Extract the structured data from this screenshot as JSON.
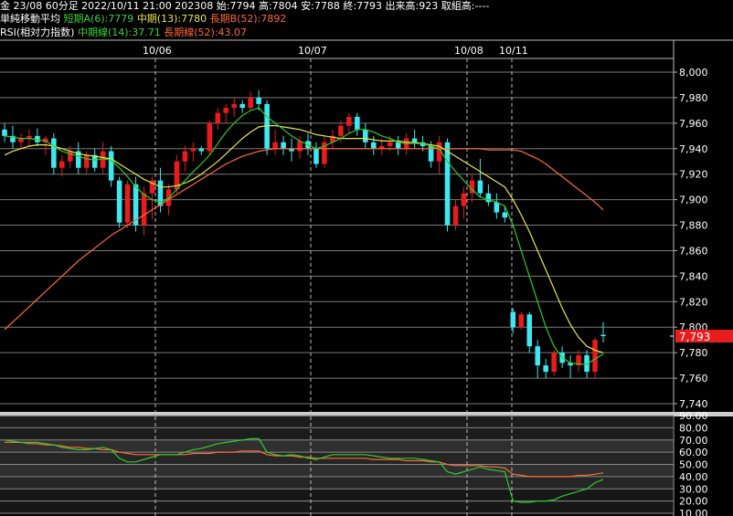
{
  "header": {
    "line1": "金 23/08 60分足 2022/10/11 21:00 202308 始:7794 高:7804 安:7788 終:7793 出来高:923 取組高:----",
    "line2_prefix": "単純移動平均",
    "line2_short": "短期A(6):7779",
    "line2_mid": "中期(13):7780",
    "line2_long": "長期B(52):7892",
    "line3_prefix": "RSI(相対力指数)",
    "line3_mid": "中期線(14):37.71",
    "line3_long": "長期線(52):43.07"
  },
  "colors": {
    "up": "#e81c1c",
    "down": "#3ee8f0",
    "ma_short": "#2ecc2e",
    "ma_mid": "#e8e84a",
    "ma_long": "#ff6a3a",
    "last_price_bg": "#e81c1c"
  },
  "chart_data": [
    {
      "type": "candlestick",
      "title": "金 23/08 60分足",
      "date_labels": [
        "10/06",
        "10/07",
        "10/08",
        "10/11"
      ],
      "date_separators": [
        170,
        340,
        511,
        560
      ],
      "ylim": [
        7735,
        8005
      ],
      "yticks": [
        8000,
        7980,
        7960,
        7940,
        7920,
        7900,
        7880,
        7860,
        7840,
        7820,
        7800,
        7780,
        7760,
        7740
      ],
      "ytick_labels": [
        "8,000",
        "7,980",
        "7,960",
        "7,940",
        "7,920",
        "7,900",
        "7,880",
        "7,860",
        "7,840",
        "7,820",
        "7,800",
        "7,780",
        "7,760",
        "7,740"
      ],
      "last_price": 7793,
      "last_price_label": "7,793",
      "candles": [
        [
          7955,
          7960,
          7945,
          7950
        ],
        [
          7950,
          7958,
          7940,
          7945
        ],
        [
          7945,
          7952,
          7940,
          7948
        ],
        [
          7948,
          7955,
          7942,
          7950
        ],
        [
          7950,
          7956,
          7942,
          7945
        ],
        [
          7945,
          7950,
          7935,
          7948
        ],
        [
          7948,
          7952,
          7920,
          7925
        ],
        [
          7925,
          7935,
          7918,
          7930
        ],
        [
          7930,
          7942,
          7925,
          7938
        ],
        [
          7938,
          7945,
          7920,
          7925
        ],
        [
          7925,
          7938,
          7920,
          7935
        ],
        [
          7935,
          7940,
          7922,
          7925
        ],
        [
          7925,
          7945,
          7920,
          7938
        ],
        [
          7938,
          7942,
          7910,
          7915
        ],
        [
          7915,
          7918,
          7878,
          7882
        ],
        [
          7882,
          7915,
          7878,
          7912
        ],
        [
          7912,
          7918,
          7875,
          7880
        ],
        [
          7880,
          7910,
          7872,
          7905
        ],
        [
          7905,
          7918,
          7885,
          7915
        ],
        [
          7915,
          7925,
          7890,
          7895
        ],
        [
          7895,
          7912,
          7888,
          7908
        ],
        [
          7908,
          7935,
          7905,
          7930
        ],
        [
          7930,
          7942,
          7922,
          7938
        ],
        [
          7938,
          7945,
          7930,
          7940
        ],
        [
          7940,
          7942,
          7935,
          7938
        ],
        [
          7938,
          7962,
          7935,
          7960
        ],
        [
          7960,
          7972,
          7955,
          7968
        ],
        [
          7968,
          7975,
          7960,
          7972
        ],
        [
          7972,
          7980,
          7965,
          7975
        ],
        [
          7975,
          7978,
          7968,
          7972
        ],
        [
          7972,
          7985,
          7970,
          7980
        ],
        [
          7980,
          7986,
          7970,
          7975
        ],
        [
          7975,
          7978,
          7935,
          7940
        ],
        [
          7940,
          7955,
          7935,
          7945
        ],
        [
          7945,
          7950,
          7935,
          7940
        ],
        [
          7940,
          7948,
          7930,
          7938
        ],
        [
          7938,
          7950,
          7932,
          7946
        ],
        [
          7946,
          7952,
          7935,
          7940
        ],
        [
          7940,
          7945,
          7925,
          7928
        ],
        [
          7928,
          7950,
          7925,
          7945
        ],
        [
          7945,
          7955,
          7940,
          7950
        ],
        [
          7950,
          7962,
          7945,
          7958
        ],
        [
          7958,
          7968,
          7952,
          7965
        ],
        [
          7965,
          7968,
          7950,
          7955
        ],
        [
          7955,
          7960,
          7940,
          7945
        ],
        [
          7945,
          7950,
          7935,
          7940
        ],
        [
          7940,
          7948,
          7935,
          7942
        ],
        [
          7942,
          7950,
          7938,
          7945
        ],
        [
          7945,
          7950,
          7935,
          7940
        ],
        [
          7940,
          7952,
          7935,
          7948
        ],
        [
          7948,
          7955,
          7940,
          7945
        ],
        [
          7945,
          7950,
          7938,
          7942
        ],
        [
          7942,
          7946,
          7925,
          7930
        ],
        [
          7930,
          7950,
          7920,
          7945
        ],
        [
          7945,
          7948,
          7875,
          7880
        ],
        [
          7880,
          7900,
          7876,
          7895
        ],
        [
          7895,
          7910,
          7885,
          7905
        ],
        [
          7905,
          7920,
          7898,
          7915
        ],
        [
          7915,
          7932,
          7902,
          7905
        ],
        [
          7905,
          7912,
          7895,
          7898
        ],
        [
          7898,
          7905,
          7885,
          7890
        ],
        [
          7890,
          7895,
          7882,
          7886
        ],
        [
          7812,
          7815,
          7795,
          7800
        ],
        [
          7800,
          7812,
          7798,
          7810
        ],
        [
          7810,
          7812,
          7780,
          7785
        ],
        [
          7785,
          7790,
          7760,
          7770
        ],
        [
          7770,
          7775,
          7760,
          7765
        ],
        [
          7765,
          7782,
          7762,
          7780
        ],
        [
          7780,
          7785,
          7768,
          7772
        ],
        [
          7772,
          7778,
          7760,
          7770
        ],
        [
          7770,
          7782,
          7765,
          7778
        ],
        [
          7778,
          7782,
          7760,
          7765
        ],
        [
          7765,
          7792,
          7760,
          7790
        ],
        [
          7794,
          7804,
          7788,
          7793
        ]
      ],
      "ma_short": [
        7950,
        7949,
        7948,
        7948,
        7947,
        7946,
        7942,
        7938,
        7936,
        7934,
        7932,
        7931,
        7932,
        7931,
        7925,
        7918,
        7910,
        7904,
        7900,
        7898,
        7901,
        7908,
        7915,
        7922,
        7928,
        7935,
        7944,
        7953,
        7960,
        7966,
        7970,
        7972,
        7965,
        7960,
        7955,
        7950,
        7946,
        7943,
        7940,
        7942,
        7945,
        7948,
        7952,
        7955,
        7955,
        7953,
        7950,
        7948,
        7945,
        7944,
        7944,
        7944,
        7942,
        7940,
        7930,
        7922,
        7915,
        7908,
        7902,
        7900,
        7898,
        7895,
        7880,
        7860,
        7840,
        7820,
        7800,
        7785,
        7776,
        7772,
        7771,
        7771,
        7775,
        7779
      ],
      "ma_mid": [
        7935,
        7938,
        7940,
        7942,
        7943,
        7943,
        7942,
        7940,
        7938,
        7936,
        7935,
        7934,
        7933,
        7932,
        7928,
        7924,
        7920,
        7916,
        7913,
        7910,
        7910,
        7911,
        7913,
        7916,
        7920,
        7925,
        7930,
        7936,
        7942,
        7948,
        7953,
        7957,
        7958,
        7958,
        7957,
        7956,
        7955,
        7953,
        7951,
        7950,
        7949,
        7948,
        7948,
        7948,
        7948,
        7947,
        7946,
        7946,
        7946,
        7945,
        7945,
        7944,
        7943,
        7942,
        7938,
        7934,
        7930,
        7926,
        7922,
        7918,
        7914,
        7910,
        7900,
        7888,
        7875,
        7860,
        7845,
        7830,
        7815,
        7802,
        7792,
        7785,
        7782,
        7780
      ],
      "ma_long": [
        7798,
        7804,
        7810,
        7816,
        7822,
        7828,
        7834,
        7840,
        7846,
        7852,
        7857,
        7862,
        7867,
        7872,
        7876,
        7880,
        7884,
        7888,
        7892,
        7896,
        7900,
        7904,
        7908,
        7912,
        7916,
        7920,
        7924,
        7928,
        7931,
        7934,
        7936,
        7938,
        7939,
        7940,
        7940,
        7940,
        7940,
        7940,
        7940,
        7940,
        7940,
        7940,
        7940,
        7940,
        7940,
        7940,
        7940,
        7940,
        7940,
        7940,
        7940,
        7940,
        7940,
        7940,
        7940,
        7940,
        7940,
        7940,
        7940,
        7939,
        7939,
        7939,
        7939,
        7938,
        7935,
        7932,
        7928,
        7923,
        7918,
        7913,
        7908,
        7903,
        7898,
        7892
      ]
    },
    {
      "type": "line",
      "title": "RSI(相対力指数)",
      "ylim": [
        7,
        93
      ],
      "yticks": [
        90,
        80,
        70,
        60,
        50,
        40,
        30,
        20,
        10
      ],
      "ytick_labels": [
        "90.00",
        "80.00",
        "70.00",
        "60.00",
        "50.00",
        "40.00",
        "30.00",
        "20.00",
        "10.00"
      ],
      "series": [
        {
          "name": "中期線(14)",
          "values": [
            70,
            69,
            68,
            68,
            68,
            67,
            66,
            64,
            63,
            62,
            62,
            63,
            64,
            62,
            55,
            52,
            52,
            54,
            56,
            58,
            58,
            58,
            60,
            62,
            63,
            65,
            67,
            68,
            69,
            70,
            71,
            71,
            60,
            58,
            57,
            58,
            57,
            55,
            54,
            56,
            58,
            58,
            58,
            58,
            58,
            57,
            56,
            55,
            55,
            55,
            55,
            54,
            53,
            52,
            44,
            42,
            44,
            46,
            48,
            46,
            45,
            44,
            20,
            19,
            19,
            20,
            20,
            21,
            24,
            26,
            28,
            30,
            35,
            37.71
          ]
        },
        {
          "name": "長期線(52)",
          "values": [
            68,
            68,
            68,
            67,
            67,
            66,
            66,
            65,
            64,
            64,
            63,
            63,
            62,
            62,
            60,
            59,
            58,
            58,
            58,
            58,
            58,
            58,
            58,
            59,
            59,
            59,
            60,
            60,
            60,
            61,
            61,
            61,
            58,
            57,
            57,
            57,
            56,
            56,
            55,
            55,
            55,
            55,
            55,
            55,
            55,
            54,
            54,
            54,
            54,
            53,
            53,
            53,
            52,
            52,
            50,
            49,
            49,
            49,
            49,
            48,
            48,
            47,
            42,
            41,
            40,
            40,
            40,
            40,
            40,
            40,
            41,
            41,
            42,
            43.07
          ]
        }
      ]
    }
  ]
}
